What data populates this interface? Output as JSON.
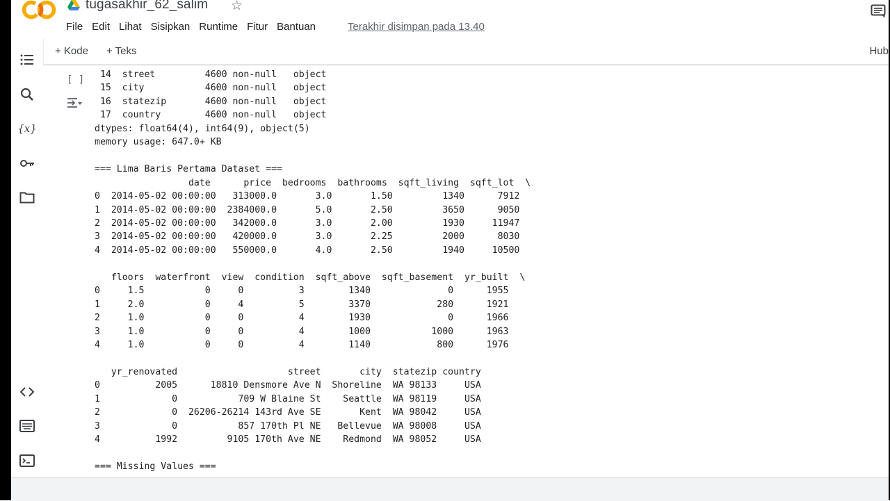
{
  "header": {
    "title": "tugasakhir_62_salim",
    "menu": [
      "File",
      "Edit",
      "Lihat",
      "Sisipkan",
      "Runtime",
      "Fitur",
      "Bantuan"
    ],
    "saved_status": "Terakhir disimpan pada 13.40"
  },
  "toolbar": {
    "add_code": "+ Kode",
    "add_text": "+ Teks",
    "connect": "Hub"
  },
  "sidebar": {
    "icons": [
      "toc-icon",
      "search-icon",
      "variables-icon",
      "secrets-key-icon",
      "folder-icon",
      "code-snippets-icon",
      "command-palette-icon",
      "terminal-icon"
    ]
  },
  "cell": {
    "bracket": "[ ]",
    "output_lines": [
      " 14  street         4600 non-null   object",
      " 15  city           4600 non-null   object",
      " 16  statezip       4600 non-null   object",
      " 17  country        4600 non-null   object",
      "dtypes: float64(4), int64(9), object(5)",
      "memory usage: 647.0+ KB",
      "",
      "=== Lima Baris Pertama Dataset ===",
      "                 date      price  bedrooms  bathrooms  sqft_living  sqft_lot  \\",
      "0  2014-05-02 00:00:00   313000.0       3.0       1.50         1340      7912",
      "1  2014-05-02 00:00:00  2384000.0       5.0       2.50         3650      9050",
      "2  2014-05-02 00:00:00   342000.0       3.0       2.00         1930     11947",
      "3  2014-05-02 00:00:00   420000.0       3.0       2.25         2000      8030",
      "4  2014-05-02 00:00:00   550000.0       4.0       2.50         1940     10500",
      "",
      "   floors  waterfront  view  condition  sqft_above  sqft_basement  yr_built  \\",
      "0     1.5           0     0          3        1340              0      1955",
      "1     2.0           0     4          5        3370            280      1921",
      "2     1.0           0     0          4        1930              0      1966",
      "3     1.0           0     0          4        1000           1000      1963",
      "4     1.0           0     0          4        1140            800      1976",
      "",
      "   yr_renovated                    street       city  statezip country",
      "0          2005      18810 Densmore Ave N  Shoreline  WA 98133     USA",
      "1             0           709 W Blaine St    Seattle  WA 98119     USA",
      "2             0  26206-26214 143rd Ave SE       Kent  WA 98042     USA",
      "3             0           857 170th Pl NE   Bellevue  WA 98008     USA",
      "4          1992         9105 170th Ave NE    Redmond  WA 98052     USA",
      "",
      "=== Missing Values ==="
    ]
  },
  "colors": {
    "logo_orange": "#F9AB00",
    "logo_dark_orange": "#E8710A",
    "drive_blue": "#4285F4",
    "drive_green": "#0F9D58",
    "drive_yellow": "#FFBA00"
  }
}
